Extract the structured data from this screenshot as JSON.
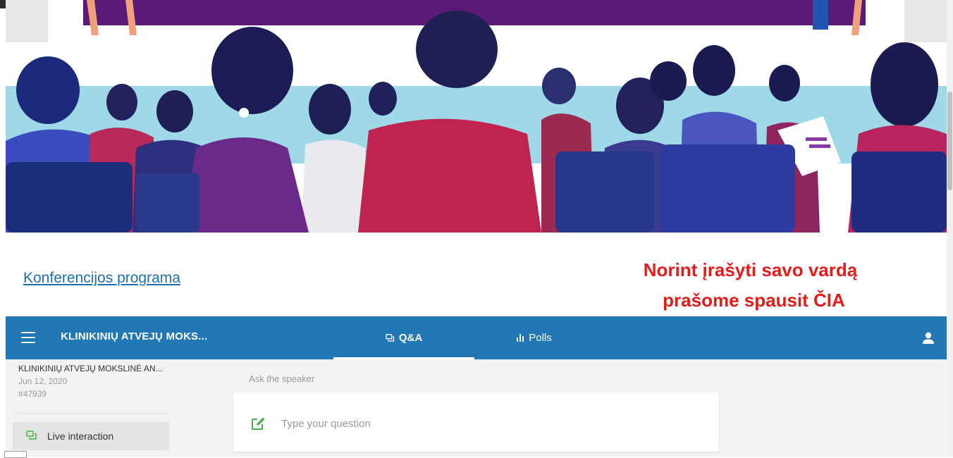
{
  "page": {
    "program_link": "Konferencijos programa",
    "annotation": {
      "line1": "Norint įrašyti savo vardą",
      "line2": "prašome spausit ČIA",
      "color": "#e51c1c"
    }
  },
  "appbar": {
    "event_name": "KLINIKINIŲ ATVEJŲ MOKS...",
    "tabs": [
      {
        "label": "Q&A",
        "icon": "chat-bubbles-icon",
        "active": true
      },
      {
        "label": "Polls",
        "icon": "bar-chart-icon",
        "active": false
      }
    ],
    "background": "#2277b5",
    "user_icon": "person-icon"
  },
  "sidebar": {
    "event_title": "KLINIKINIŲ ATVEJŲ MOKSLINĖ AN...",
    "date": "Jun 12, 2020",
    "event_id": "#47939",
    "items": [
      {
        "label": "Live interaction",
        "icon": "chat-bubbles-icon",
        "active": true
      }
    ]
  },
  "qa": {
    "section_label": "Ask the speaker",
    "input_placeholder": "Type your question",
    "input_icon": "edit-icon",
    "accent": "#4caf50"
  }
}
